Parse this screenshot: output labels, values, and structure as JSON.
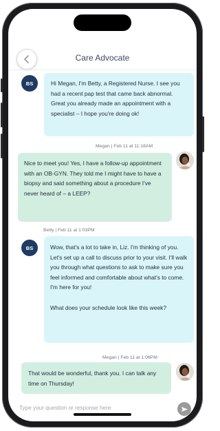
{
  "header": {
    "title": "Care Advocate",
    "back_icon": "chevron-left-icon"
  },
  "messages": [
    {
      "sender": "nurse",
      "avatar_initials": "BS",
      "text": "Hi Megan, I'm Betty, a Registered Nurse. I see you had a recent pap test that came back abnormal. Great you already made an appointment with a specialist – I hope you're doing ok!"
    },
    {
      "sender": "user",
      "meta": "Megan  | Feb 11 at 11:18AM",
      "text": "Nice to meet you! Yes, I have a follow-up appointment with an OB-GYN. They told me I might have to have a biopsy and said something about a procedure I've never heard of – a LEEP?"
    },
    {
      "sender": "nurse",
      "meta": "Betty | Feb 11 at 1:03PM",
      "avatar_initials": "BS",
      "text": "Wow, that's a lot to take in, Liz. I'm thinking of you.  Let's set up a call to discuss prior to your visit. I'll walk you through what questions to ask to make sure you feel informed and comfortable about what's to come. I'm here for you!\n\nWhat does your schedule look like this week?"
    },
    {
      "sender": "user",
      "meta": "Megan  | Feb 11 at 1:06PM",
      "text": "That would be wonderful, thank you. I can talk any time on Thursday!"
    }
  ],
  "composer": {
    "placeholder": "Type your question or response here",
    "send_icon": "send-arrow-icon"
  },
  "colors": {
    "nurse_bubble": "#daf5f9",
    "user_bubble": "#d2eee1",
    "avatar": "#1f3a63"
  }
}
